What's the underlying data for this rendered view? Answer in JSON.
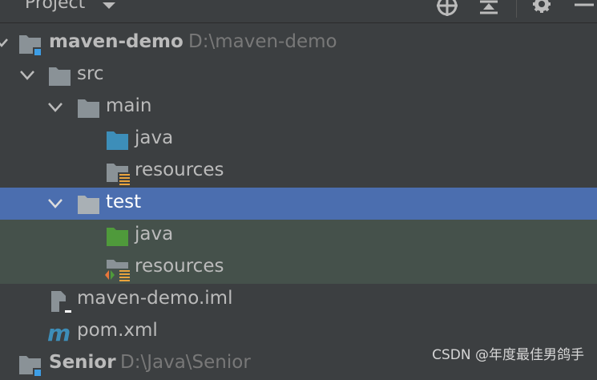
{
  "header": {
    "title": "Project"
  },
  "tree": [
    {
      "label": "maven-demo",
      "path": "D:\\maven-demo"
    },
    {
      "label": "src"
    },
    {
      "label": "main"
    },
    {
      "label": "java"
    },
    {
      "label": "resources"
    },
    {
      "label": "test"
    },
    {
      "label": "java"
    },
    {
      "label": "resources"
    },
    {
      "label": "maven-demo.iml"
    },
    {
      "label": "pom.xml"
    },
    {
      "label": "Senior",
      "path": "D:\\Java\\Senior"
    }
  ],
  "watermark": "CSDN @年度最佳男鸽手",
  "colors": {
    "selection": "#4b6eaf",
    "test_tint": "#45514b",
    "folder": "#8a9297",
    "source_root": "#3d8eb9",
    "test_root": "#4f9a3b",
    "resource_stripes": "#e8a33d"
  },
  "icons": [
    "search-icon",
    "collapse-icon",
    "gear-icon",
    "minimize-icon",
    "module-folder-icon",
    "folder-icon",
    "source-folder-icon",
    "resources-folder-icon",
    "test-source-folder-icon",
    "test-resources-folder-icon",
    "iml-file-icon",
    "maven-icon",
    "chevron-down-icon"
  ]
}
